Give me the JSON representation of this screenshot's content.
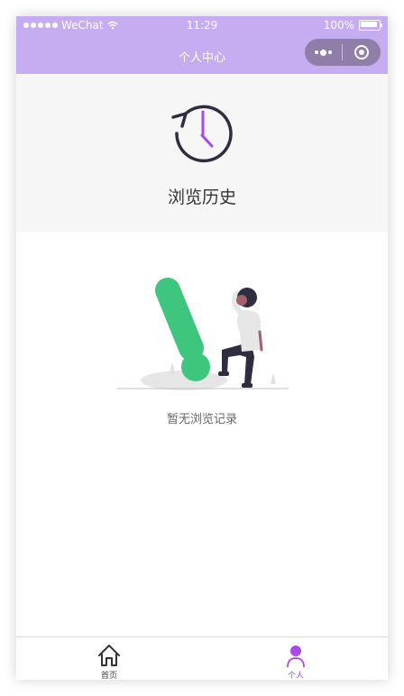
{
  "status_bar": {
    "carrier": "WeChat",
    "time": "11:29",
    "battery": "100%"
  },
  "nav_bar": {
    "title": "个人中心",
    "capsule": {
      "more_icon": "more-dots-icon",
      "close_icon": "target-icon"
    }
  },
  "header": {
    "icon": "history-clock-icon",
    "title": "浏览历史"
  },
  "empty_state": {
    "illustration": "exclamation-person-illustration",
    "text": "暂无浏览记录"
  },
  "tab_bar": {
    "items": [
      {
        "label": "首页",
        "icon": "home-icon",
        "active": false
      },
      {
        "label": "个人",
        "icon": "person-icon",
        "active": true
      }
    ]
  },
  "colors": {
    "nav_background": "#c6adf1",
    "accent": "#a84be6",
    "illustration_green": "#3ec67f"
  }
}
